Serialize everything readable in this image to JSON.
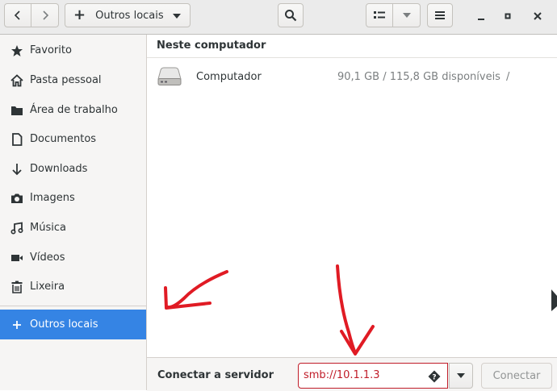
{
  "header": {
    "location_label": "Outros locais",
    "icons": {
      "back": "go-back-icon",
      "forward": "go-forward-icon",
      "add": "plus-icon",
      "search": "search-icon",
      "view": "grid-view-icon",
      "view_options": "chevron-down-icon",
      "menu": "hamburger-menu-icon",
      "minimize": "minimize-icon",
      "maximize": "maximize-icon",
      "close": "close-icon"
    }
  },
  "sidebar": {
    "items": [
      {
        "label": "Favorito",
        "icon": "star-icon"
      },
      {
        "label": "Pasta pessoal",
        "icon": "home-icon"
      },
      {
        "label": "Área de trabalho",
        "icon": "folder-icon"
      },
      {
        "label": "Documentos",
        "icon": "document-icon"
      },
      {
        "label": "Downloads",
        "icon": "download-icon"
      },
      {
        "label": "Imagens",
        "icon": "camera-icon"
      },
      {
        "label": "Música",
        "icon": "music-icon"
      },
      {
        "label": "Vídeos",
        "icon": "video-icon"
      },
      {
        "label": "Lixeira",
        "icon": "trash-icon"
      }
    ],
    "other_locations": {
      "label": "Outros locais",
      "icon": "plus-icon",
      "selected": true
    }
  },
  "main": {
    "section_title": "Neste computador",
    "drives": [
      {
        "name": "Computador",
        "space": "90,1 GB / 115,8 GB disponíveis",
        "path": "/",
        "icon": "hard-drive-icon"
      }
    ]
  },
  "footer": {
    "connect_label": "Conectar a servidor",
    "server_value": "smb://10.1.1.3",
    "connect_button": "Conectar",
    "colors": {
      "error": "#c01c28"
    }
  },
  "colors": {
    "accent": "#3584e4",
    "annotation": "#e01b24"
  }
}
